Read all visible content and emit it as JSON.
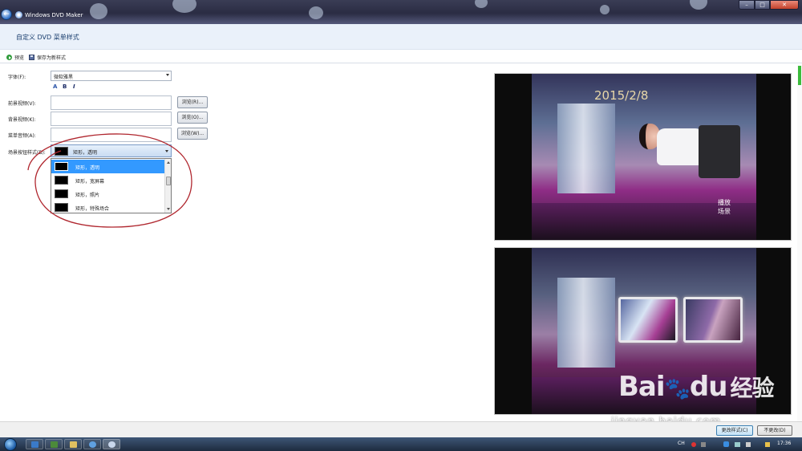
{
  "window": {
    "app_title": "Windows DVD Maker"
  },
  "header": {
    "title": "自定义 DVD 菜单样式"
  },
  "toolbar": {
    "preview_label": "预览",
    "save_style_label": "保存为新样式"
  },
  "form": {
    "font_label": "字体(F):",
    "font_value": "微软雅黑",
    "format_buttons": [
      "A",
      "B",
      "I"
    ],
    "foreground_video_label": "前景视频(V):",
    "background_video_label": "背景视频(K):",
    "menu_audio_label": "菜单音频(A):",
    "browse_buttons": [
      "浏览(R)...",
      "浏览(O)...",
      "浏览(W)..."
    ],
    "scene_style_label": "场景按钮样式(B):",
    "scene_style_value": "矩形，透明",
    "dropdown_options": [
      "矩形，透明",
      "矩形，宽屏幕",
      "矩形，照片",
      "矩形，特殊场合"
    ]
  },
  "preview": {
    "date_text": "2015/2/8",
    "scene_label_line1": "播放",
    "scene_label_line2": "场景"
  },
  "watermark": {
    "logo_text": "Bai",
    "logo_paw": "🐾",
    "logo_du": "du",
    "logo_cn": "经验",
    "url": "jingyan.baidu.com"
  },
  "footer": {
    "change_style_button": "更改样式(C)",
    "cancel_button": "不更改(D)"
  },
  "taskbar": {
    "lang": "CH",
    "time": "17:36"
  },
  "colors": {
    "accent": "#3399ff",
    "annotation": "#b0272f",
    "header_bg": "#eaf1fa"
  }
}
